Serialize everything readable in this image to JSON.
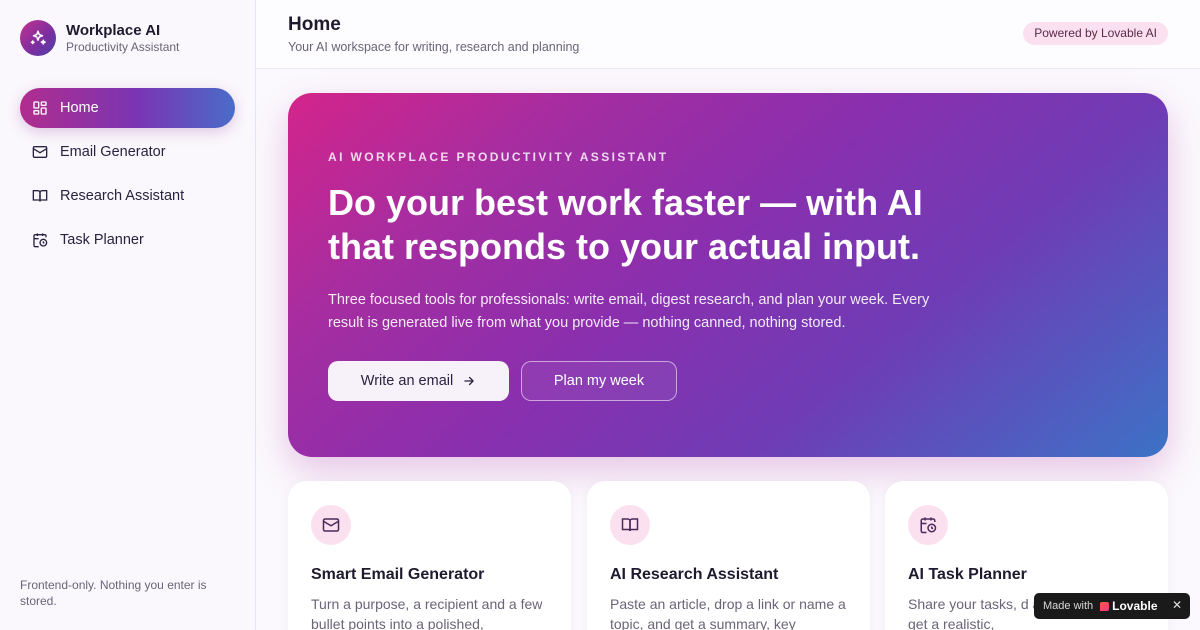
{
  "brand": {
    "name": "Workplace AI",
    "subtitle": "Productivity Assistant",
    "logo_icon": "sparkles-icon"
  },
  "sidebar": {
    "items": [
      {
        "label": "Home",
        "icon": "grid-icon",
        "active": true
      },
      {
        "label": "Email Generator",
        "icon": "mail-icon",
        "active": false
      },
      {
        "label": "Research Assistant",
        "icon": "book-icon",
        "active": false
      },
      {
        "label": "Task Planner",
        "icon": "calendar-clock-icon",
        "active": false
      }
    ],
    "footer": "Frontend-only. Nothing you enter is stored."
  },
  "header": {
    "title": "Home",
    "subtitle": "Your AI workspace for writing, research and planning",
    "badge": "Powered by Lovable AI"
  },
  "hero": {
    "eyebrow": "AI WORKPLACE PRODUCTIVITY ASSISTANT",
    "title": "Do your best work faster — with AI that responds to your actual input.",
    "description": "Three focused tools for professionals: write email, digest research, and plan your week. Every result is generated live from what you provide — nothing canned, nothing stored.",
    "primary_button": "Write an email",
    "secondary_button": "Plan my week"
  },
  "cards": [
    {
      "title": "Smart Email Generator",
      "description": "Turn a purpose, a recipient and a few bullet points into a polished,",
      "icon": "mail-icon"
    },
    {
      "title": "AI Research Assistant",
      "description": "Paste an article, drop a link or name a topic, and get a summary, key",
      "icon": "book-icon"
    },
    {
      "title": "AI Task Planner",
      "description": "Share your tasks, d available hours to get a realistic,",
      "icon": "calendar-clock-icon"
    }
  ],
  "lovable_badge": {
    "made_with": "Made with",
    "brand": "Lovable",
    "close": "✕"
  },
  "colors": {
    "accent_pink": "#d4248b",
    "accent_purple": "#8a2fae",
    "accent_blue": "#3c72c6",
    "badge_bg": "#fbe0ef"
  }
}
